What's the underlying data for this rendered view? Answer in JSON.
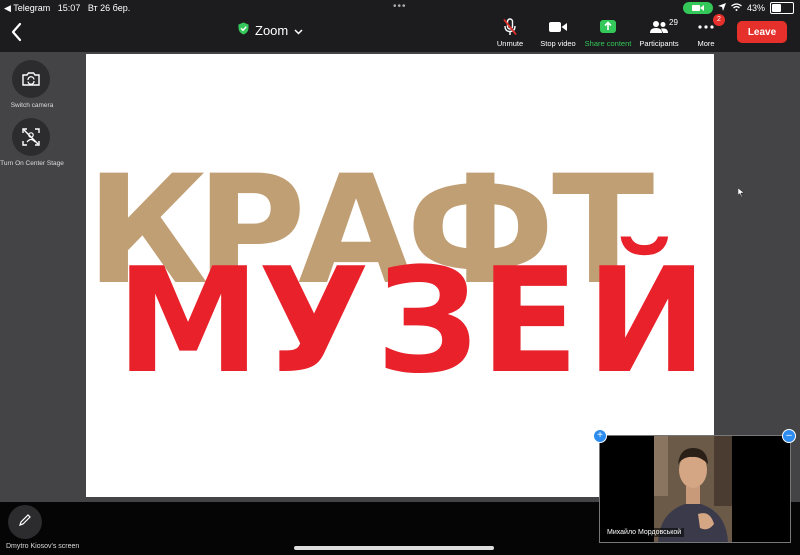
{
  "status_bar": {
    "back_app": "◀ Telegram",
    "time": "15:07",
    "date": "Вт 26 бер.",
    "battery": "43%",
    "battery_level": 0.43
  },
  "header": {
    "title": "Zoom",
    "shield_color": "#34c759"
  },
  "toolbar": {
    "unmute": "Unmute",
    "stop_video": "Stop video",
    "share_content": "Share content",
    "participants": "Participants",
    "participants_count": "29",
    "more": "More",
    "more_badge": "2",
    "leave": "Leave"
  },
  "side_controls": {
    "switch_camera": "Switch camera",
    "center_stage": "Turn On Center Stage"
  },
  "shared_content": {
    "line1": [
      "К",
      "Р",
      "А",
      "Ф",
      "Т"
    ],
    "line2": [
      "М",
      "У",
      "З",
      "Е",
      "Й"
    ],
    "kraft_color": "#c19f74",
    "muzei_color": "#e8212b"
  },
  "bottom": {
    "screen_label": "Dmytro Kiosov's screen"
  },
  "pip": {
    "name": "Михайло Мордовськой"
  },
  "colors": {
    "leave": "#e5302b",
    "green": "#34c759",
    "accent_blue": "#2d8cf0"
  }
}
